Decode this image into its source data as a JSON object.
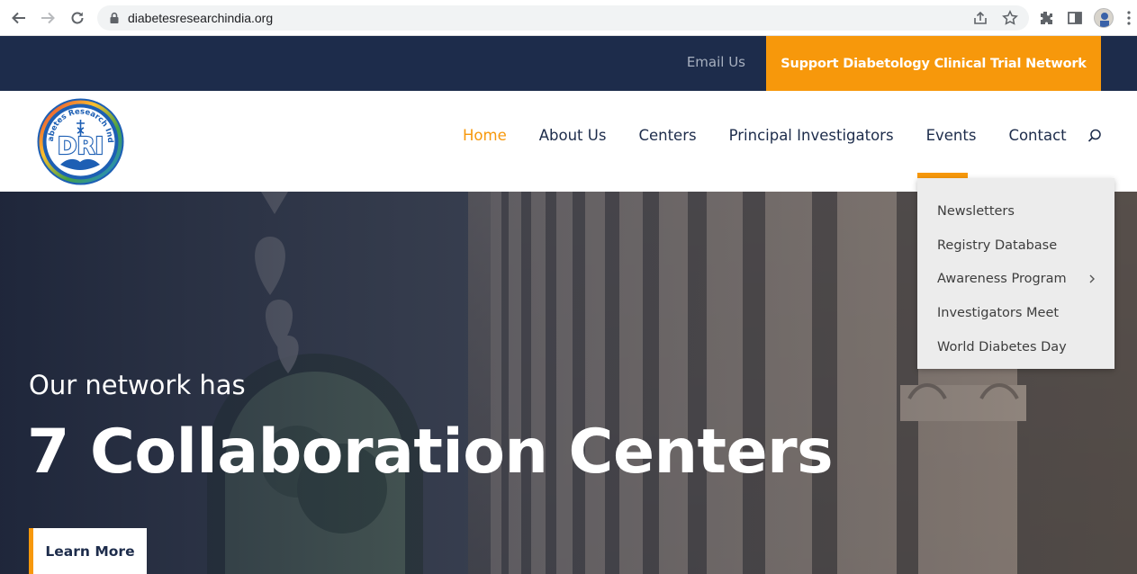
{
  "browser": {
    "url": "diabetesresearchindia.org"
  },
  "topbar": {
    "email_label": "Email Us",
    "support_label": "Support Diabetology Clinical Trial Network"
  },
  "logo": {
    "text": "DRI",
    "ring_text": "Diabetes Research India"
  },
  "nav": {
    "items": [
      {
        "label": "Home",
        "active": true
      },
      {
        "label": "About Us"
      },
      {
        "label": "Centers"
      },
      {
        "label": "Principal Investigators"
      },
      {
        "label": "Events"
      },
      {
        "label": "Contact"
      }
    ]
  },
  "dropdown": {
    "items": [
      {
        "label": "Newsletters"
      },
      {
        "label": "Registry Database"
      },
      {
        "label": "Awareness Program",
        "has_submenu": true
      },
      {
        "label": "Investigators Meet"
      },
      {
        "label": "World Diabetes Day"
      }
    ]
  },
  "hero": {
    "subtitle": "Our network has",
    "title": "7 Collaboration Centers",
    "button_label": "Learn More"
  },
  "colors": {
    "accent": "#f7980b",
    "navy": "#1d2c4b"
  }
}
